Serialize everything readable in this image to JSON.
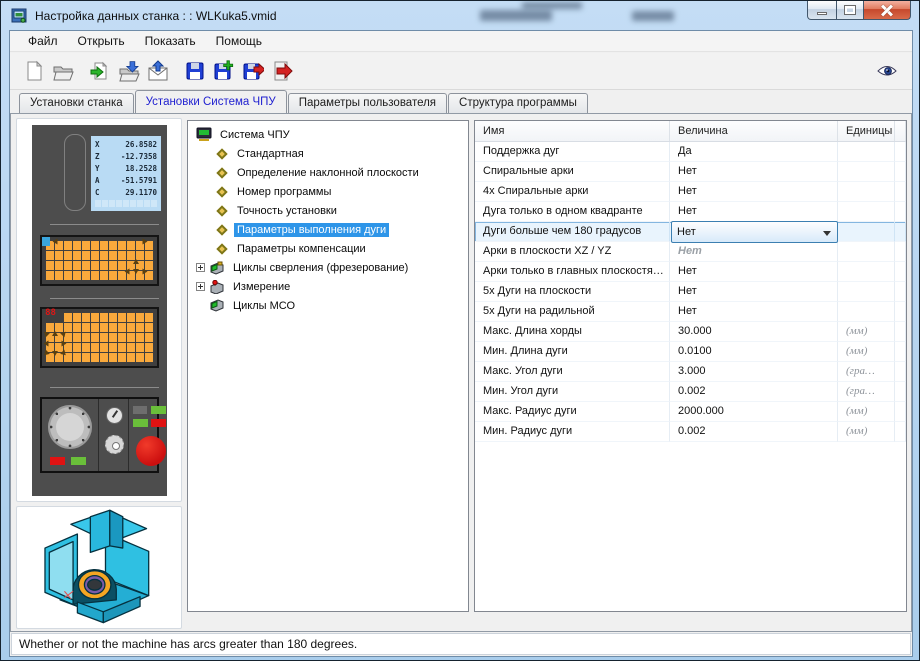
{
  "window": {
    "title": "Настройка данных станка : : WLKuka5.vmid"
  },
  "menu": {
    "items": [
      "Файл",
      "Открыть",
      "Показать",
      "Помощь"
    ]
  },
  "toolbar": {
    "buttons": [
      "new-file",
      "open-folder",
      "import-file",
      "load-file",
      "mail-upload",
      "save",
      "save-add",
      "save-export",
      "exit"
    ],
    "right_button": "preview-eye"
  },
  "tabs": {
    "active_index": 1,
    "items": [
      {
        "label": "Установки станка"
      },
      {
        "label": "Установки Система ЧПУ"
      },
      {
        "label": "Параметры пользователя"
      },
      {
        "label": "Структура программы"
      }
    ]
  },
  "machine_display": {
    "led": "88",
    "axes": [
      {
        "label": "X",
        "value": "26.8582"
      },
      {
        "label": "Z",
        "value": "-12.7358"
      },
      {
        "label": "Y",
        "value": "18.2528"
      },
      {
        "label": "A",
        "value": "-51.5791"
      },
      {
        "label": "C",
        "value": "29.1170"
      }
    ]
  },
  "tree": {
    "items": [
      {
        "label": "Система ЧПУ",
        "icon": "cnc-system-icon",
        "level": 0
      },
      {
        "label": "Стандартная",
        "icon": "diamond-icon",
        "level": 1
      },
      {
        "label": "Определение наклонной плоскости",
        "icon": "diamond-icon",
        "level": 1
      },
      {
        "label": "Номер программы",
        "icon": "diamond-icon",
        "level": 1
      },
      {
        "label": "Точность установки",
        "icon": "diamond-icon",
        "level": 1
      },
      {
        "label": "Параметры выполнения дуги",
        "icon": "diamond-icon",
        "level": 1,
        "selected": true
      },
      {
        "label": "Параметры компенсации",
        "icon": "diamond-icon",
        "level": 1
      },
      {
        "label": "Циклы сверления (фрезерование)",
        "icon": "drill-cycles-icon",
        "level": 1,
        "expandable": true
      },
      {
        "label": "Измерение",
        "icon": "measure-probe-icon",
        "level": 1,
        "expandable": true
      },
      {
        "label": "Циклы МСО",
        "icon": "mco-cycles-icon",
        "level": 1
      }
    ]
  },
  "table": {
    "headers": [
      "Имя",
      "Величина",
      "Единицы"
    ],
    "rows": [
      {
        "name": "Поддержка дуг",
        "value": "Да",
        "units": ""
      },
      {
        "name": "Спиральные арки",
        "value": "Нет",
        "units": ""
      },
      {
        "name": "4х Спиральные арки",
        "value": "Нет",
        "units": ""
      },
      {
        "name": "Дуга только в одном квадранте",
        "value": "Нет",
        "units": ""
      },
      {
        "name": "Дуги больше чем 180 градусов",
        "value": "Нет",
        "units": "",
        "state": "selected-combobox"
      },
      {
        "name": "Арки в  плоскости XZ / YZ",
        "value": "Нет",
        "units": "",
        "state": "disabled"
      },
      {
        "name": "Арки только в  главных плоскостя…",
        "value": "Нет",
        "units": ""
      },
      {
        "name": "5х Дуги на плоскости",
        "value": "Нет",
        "units": ""
      },
      {
        "name": "5х Дуги на радильной",
        "value": "Нет",
        "units": ""
      },
      {
        "name": "Макс. Длина хорды",
        "value": "30.000",
        "units": "(мм)"
      },
      {
        "name": "Мин. Длина дуги",
        "value": "0.0100",
        "units": "(мм)"
      },
      {
        "name": "Макс. Угол дуги",
        "value": "3.000",
        "units": "(гра…"
      },
      {
        "name": "Мин. Угол дуги",
        "value": "0.002",
        "units": "(гра…"
      },
      {
        "name": "Макс. Радиус дуги",
        "value": "2000.000",
        "units": "(мм)"
      },
      {
        "name": "Мин. Радиус дуги",
        "value": "0.002",
        "units": "(мм)"
      }
    ]
  },
  "status": {
    "text": "Whether or not the machine has arcs greater than 180 degrees."
  },
  "colors": {
    "selection": "#2e95e8",
    "active_tab_text": "#1f1fd0",
    "key_orange": "#f9a93c",
    "led_red": "#e01616",
    "machine_cyan": "#29b7dd",
    "titlebar": "#b4d4f0"
  }
}
